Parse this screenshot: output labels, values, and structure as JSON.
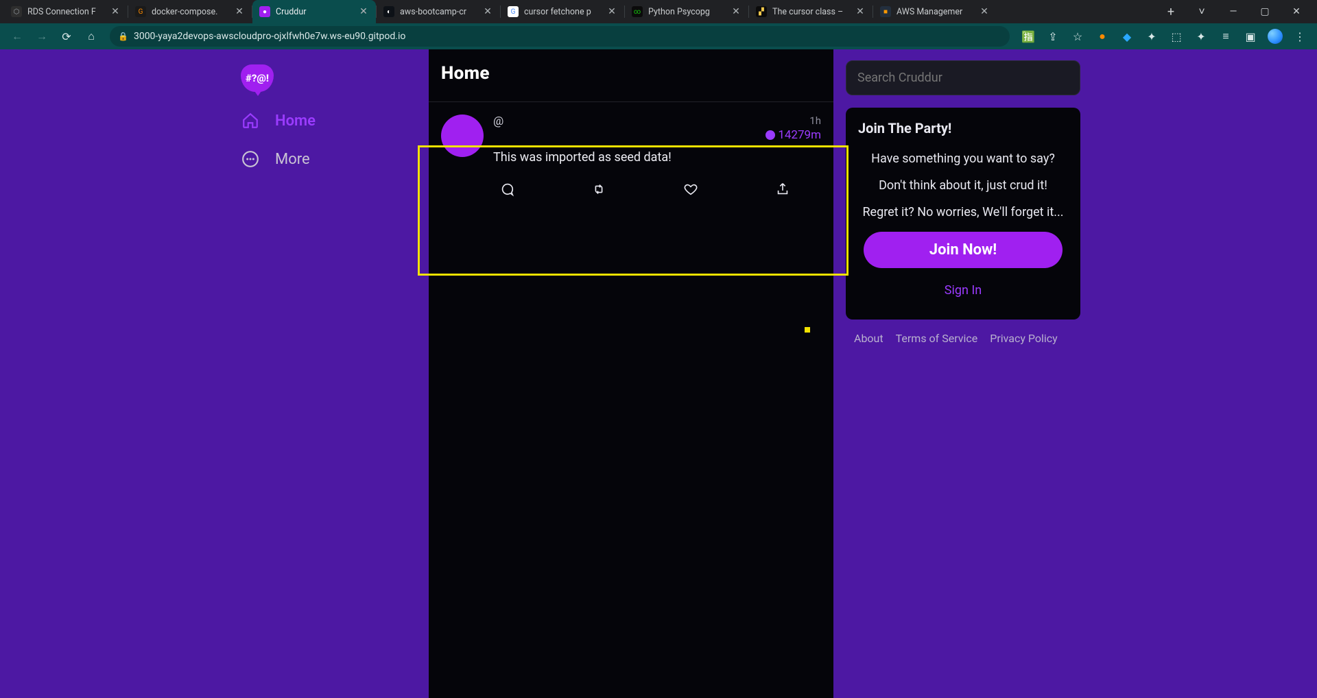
{
  "browser": {
    "tabs": [
      {
        "title": "RDS Connection F",
        "favicon_bg": "#2e2e2e",
        "favicon_fg": "#9aa0a6",
        "favicon_text": "⬡",
        "active": false
      },
      {
        "title": "docker-compose.",
        "favicon_bg": "#1a1a1a",
        "favicon_fg": "#ff8a00",
        "favicon_text": "G",
        "active": false
      },
      {
        "title": "Cruddur",
        "favicon_bg": "#a020f0",
        "favicon_fg": "#ffffff",
        "favicon_text": "●",
        "active": true
      },
      {
        "title": "aws-bootcamp-cr",
        "favicon_bg": "#0d1117",
        "favicon_fg": "#ffffff",
        "favicon_text": "◐",
        "active": false
      },
      {
        "title": "cursor fetchone p",
        "favicon_bg": "#ffffff",
        "favicon_fg": "#4285f4",
        "favicon_text": "G",
        "active": false
      },
      {
        "title": "Python Psycopg",
        "favicon_bg": "#0b0b0b",
        "favicon_fg": "#16c60c",
        "favicon_text": "∞",
        "active": false
      },
      {
        "title": "The cursor class –",
        "favicon_bg": "#0b0b0b",
        "favicon_fg": "#f2c94c",
        "favicon_text": "▞",
        "active": false
      },
      {
        "title": "AWS Managemer",
        "favicon_bg": "#232f3e",
        "favicon_fg": "#ff9900",
        "favicon_text": "■",
        "active": false
      }
    ],
    "new_tab_tooltip": "+",
    "window_controls": {
      "menu": "˅",
      "min": "—",
      "max": "▢",
      "close": "✕"
    },
    "url": "3000-yaya2devops-awscloudpro-ojxlfwh0e7w.ws-eu90.gitpod.io"
  },
  "app": {
    "nav": {
      "home": "Home",
      "more": "More"
    },
    "feed": {
      "title": "Home",
      "post": {
        "handle": "@",
        "time": "1h",
        "expires": "14279m",
        "content": "This was imported as seed data!"
      }
    },
    "search": {
      "placeholder": "Search Cruddur"
    },
    "party": {
      "title": "Join The Party!",
      "line1": "Have something you want to say?",
      "line2": "Don't think about it, just crud it!",
      "line3": "Regret it? No worries, We'll forget it...",
      "join_label": "Join Now!",
      "signin_label": "Sign In"
    },
    "footer": {
      "about": "About",
      "terms": "Terms of Service",
      "privacy": "Privacy Policy"
    }
  }
}
